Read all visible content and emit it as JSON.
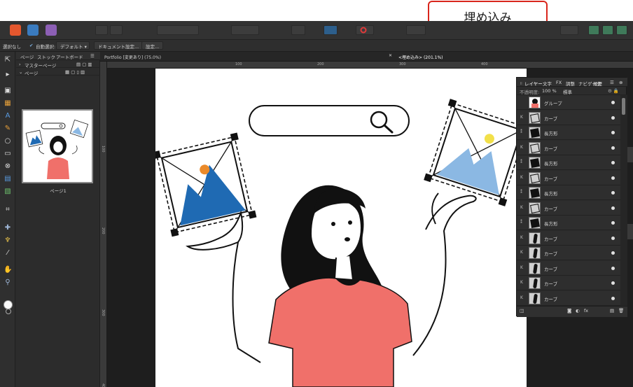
{
  "callout": {
    "text": "埋め込み"
  },
  "context_toolbar": {
    "selection": "選択なし",
    "auto_select_label": "自動選択:",
    "auto_select_value": "デフォルト",
    "document_setup_button": "ドキュメント設定...",
    "preferences_button": "設定..."
  },
  "left_panel": {
    "tabs": [
      "ページ",
      "ストック",
      "アートボード"
    ],
    "master_pages_label": "マスターページ",
    "pages_label": "ページ",
    "page_thumbnail_label": "ページ1"
  },
  "document_tabs": [
    {
      "label": "Portfolio [変更あり] (75.0%)"
    },
    {
      "label": "<埋め込み> (201.1%)"
    }
  ],
  "ruler": {
    "h_ticks": [
      "100",
      "200",
      "300",
      "400"
    ],
    "v_ticks": [
      "100",
      "200",
      "300",
      "400"
    ]
  },
  "layers_panel": {
    "tabs": [
      "レイヤー",
      "文字",
      "FX",
      "調整",
      "ナビゲータ",
      "履歴"
    ],
    "opacity_label": "不透明度:",
    "opacity_value": "100 %",
    "blend_mode": "標準",
    "layers": [
      {
        "name": "グループ",
        "type": "group"
      },
      {
        "name": "カーブ",
        "type": "curve"
      },
      {
        "name": "長方形",
        "type": "rect"
      },
      {
        "name": "カーブ",
        "type": "curve"
      },
      {
        "name": "長方形",
        "type": "rect"
      },
      {
        "name": "カーブ",
        "type": "curve"
      },
      {
        "name": "長方形",
        "type": "rect"
      },
      {
        "name": "カーブ",
        "type": "curve"
      },
      {
        "name": "長方形",
        "type": "rect"
      },
      {
        "name": "カーブ",
        "type": "curve"
      },
      {
        "name": "カーブ",
        "type": "curve"
      },
      {
        "name": "カーブ",
        "type": "curve"
      },
      {
        "name": "カーブ",
        "type": "curve"
      },
      {
        "name": "カーブ",
        "type": "curve"
      }
    ]
  },
  "colors": {
    "accent_red": "#d9261c",
    "shirt": "#f0706a",
    "mountain_blue": "#1f6ab3",
    "mountain_light": "#8bb8e3",
    "sun_orange": "#ea8a2a",
    "sun_yellow": "#f2e04a"
  }
}
